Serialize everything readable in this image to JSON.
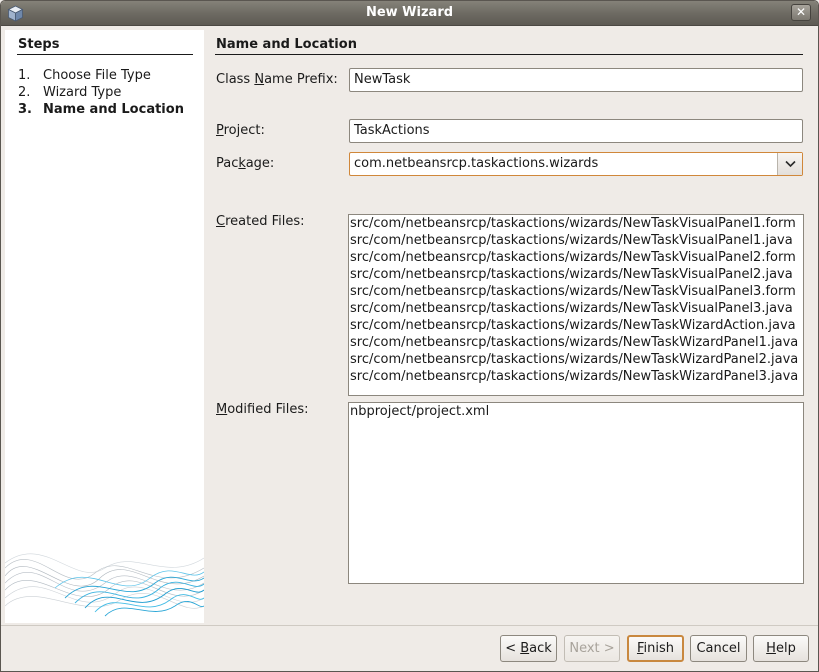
{
  "window": {
    "title": "New Wizard"
  },
  "steps": {
    "heading": "Steps",
    "items": [
      {
        "num": "1.",
        "label": "Choose File Type"
      },
      {
        "num": "2.",
        "label": "Wizard Type"
      },
      {
        "num": "3.",
        "label": "Name and Location"
      }
    ],
    "current_index": 2
  },
  "form": {
    "heading": "Name and Location",
    "class_name_prefix": {
      "label_pre": "Class ",
      "label_u": "N",
      "label_post": "ame Prefix:",
      "value": "NewTask"
    },
    "project": {
      "label_pre": "",
      "label_u": "P",
      "label_post": "roject:",
      "value": "TaskActions"
    },
    "package": {
      "label_pre": "Pac",
      "label_u": "k",
      "label_post": "age:",
      "value": "com.netbeansrcp.taskactions.wizards"
    },
    "created_files": {
      "label_pre": "",
      "label_u": "C",
      "label_post": "reated Files:",
      "lines": [
        "src/com/netbeansrcp/taskactions/wizards/NewTaskVisualPanel1.form",
        "src/com/netbeansrcp/taskactions/wizards/NewTaskVisualPanel1.java",
        "src/com/netbeansrcp/taskactions/wizards/NewTaskVisualPanel2.form",
        "src/com/netbeansrcp/taskactions/wizards/NewTaskVisualPanel2.java",
        "src/com/netbeansrcp/taskactions/wizards/NewTaskVisualPanel3.form",
        "src/com/netbeansrcp/taskactions/wizards/NewTaskVisualPanel3.java",
        "src/com/netbeansrcp/taskactions/wizards/NewTaskWizardAction.java",
        "src/com/netbeansrcp/taskactions/wizards/NewTaskWizardPanel1.java",
        "src/com/netbeansrcp/taskactions/wizards/NewTaskWizardPanel2.java",
        "src/com/netbeansrcp/taskactions/wizards/NewTaskWizardPanel3.java"
      ]
    },
    "modified_files": {
      "label_pre": "",
      "label_u": "M",
      "label_post": "odified Files:",
      "lines": [
        "nbproject/project.xml"
      ]
    }
  },
  "buttons": {
    "back": {
      "pre": "< ",
      "u": "B",
      "post": "ack"
    },
    "next": {
      "pre": "",
      "u": "",
      "post": "Next >"
    },
    "finish": {
      "pre": "",
      "u": "F",
      "post": "inish"
    },
    "cancel": {
      "pre": "",
      "u": "",
      "post": "Cancel"
    },
    "help": {
      "pre": "",
      "u": "H",
      "post": "elp"
    }
  },
  "icons": {
    "app": "netbeans-cube-icon",
    "close": "close-icon",
    "dropdown": "chevron-down-icon"
  },
  "colors": {
    "accent_focus": "#d0873a",
    "titlebar": "#6e6b63",
    "wave": "#2aa6d6"
  }
}
